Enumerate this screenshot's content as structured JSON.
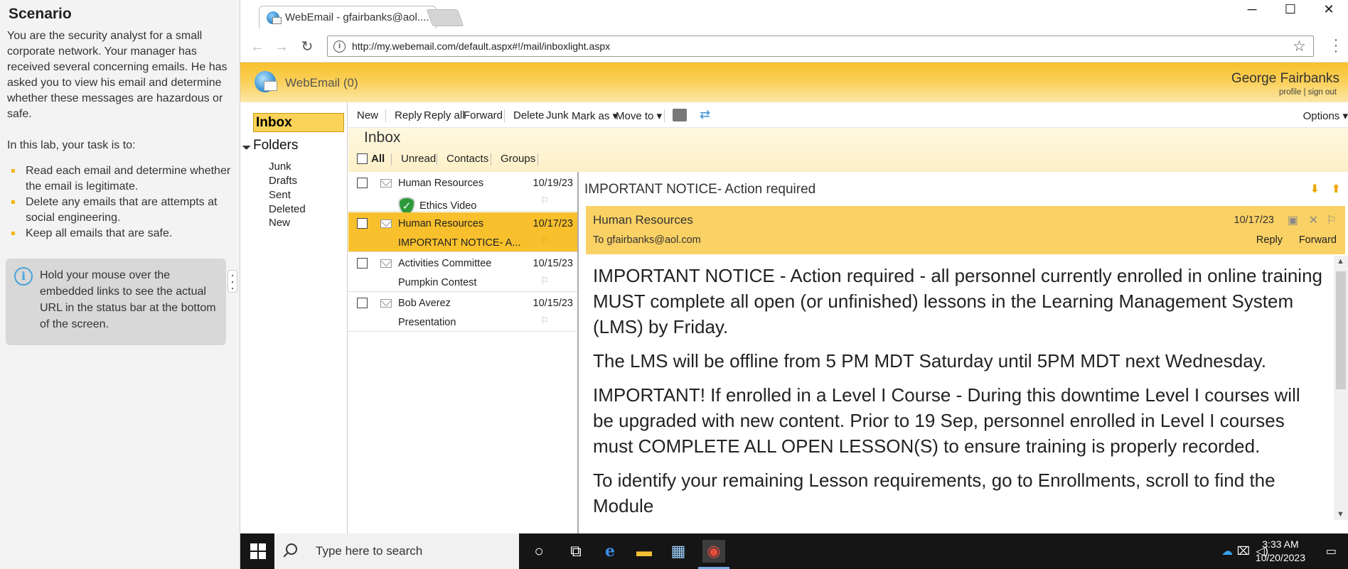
{
  "scenario": {
    "title": "Scenario",
    "intro": "You are the security analyst for a small corporate network. Your manager has received several concerning emails. He has asked you to view his email and determine whether these messages are hazardous or safe.",
    "task_intro": "In this lab, your task is to:",
    "tasks": [
      "Read each email and determine whether the email is legitimate.",
      "Delete any emails that are attempts at social engineering.",
      "Keep all emails that are safe."
    ],
    "tip": "Hold your mouse over the embedded links to see the actual URL in the status bar at the bottom of the screen.",
    "tip_icon": "info-icon"
  },
  "browser": {
    "tab_title": "WebEmail - gfairbanks@aol....",
    "url": "http://my.webemail.com/default.aspx#!/mail/inboxlight.aspx",
    "window_controls": [
      "─",
      "☐",
      "✕"
    ]
  },
  "webmail": {
    "app_title": "WebEmail (0)",
    "user_name": "George Fairbanks",
    "user_links": "profile | sign out",
    "accent_color": "#f8c02c",
    "folders": {
      "inbox": "Inbox",
      "header": "Folders",
      "items": [
        "Junk",
        "Drafts",
        "Sent",
        "Deleted",
        "New"
      ]
    },
    "commands": {
      "new": "New",
      "reply": "Reply",
      "reply_all": "Reply all",
      "forward": "Forward",
      "delete": "Delete",
      "junk": "Junk",
      "mark_as": "Mark as ▾",
      "move_to": "Move to ▾",
      "options": "Options ▾"
    },
    "list_title": "Inbox",
    "filters": [
      "All",
      "Unread",
      "Contacts",
      "Groups"
    ],
    "messages": [
      {
        "from": "Human Resources",
        "date": "10/19/23",
        "subject": "Ethics Video",
        "selected": false,
        "verified": true
      },
      {
        "from": "Human Resources",
        "date": "10/17/23",
        "subject": "IMPORTANT NOTICE- A...",
        "selected": true,
        "verified": false
      },
      {
        "from": "Activities Committee",
        "date": "10/15/23",
        "subject": "Pumpkin Contest",
        "selected": false,
        "verified": false
      },
      {
        "from": "Bob Averez",
        "date": "10/15/23",
        "subject": "Presentation",
        "selected": false,
        "verified": false
      }
    ],
    "reading": {
      "subject": "IMPORTANT NOTICE- Action required",
      "from": "Human Resources",
      "date": "10/17/23",
      "to": "To gfairbanks@aol.com",
      "reply": "Reply",
      "forward": "Forward",
      "body": [
        "IMPORTANT NOTICE - Action required - all personnel currently enrolled in online training MUST complete all open (or unfinished) lessons in the Learning Management System (LMS) by Friday.",
        "The LMS will be offline from 5 PM MDT Saturday until 5PM MDT next Wednesday.",
        "IMPORTANT! If enrolled in a Level I Course - During this downtime Level I courses will be upgraded with new content. Prior to 19 Sep, personnel enrolled in Level I courses must COMPLETE ALL OPEN LESSON(S) to ensure training is properly recorded.",
        "To identify your remaining Lesson requirements, go to Enrollments, scroll to find the Module"
      ]
    }
  },
  "taskbar": {
    "search_placeholder": "Type here to search",
    "time": "3:33 AM",
    "date": "10/20/2023"
  }
}
